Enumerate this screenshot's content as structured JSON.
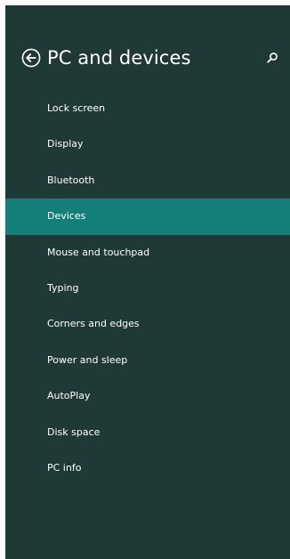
{
  "header": {
    "title": "PC and devices",
    "back_icon": "back-arrow-circle-icon",
    "search_icon": "search-icon"
  },
  "colors": {
    "panel_background": "#1f3a36",
    "selected_background": "#138077",
    "text": "#ffffff"
  },
  "nav": {
    "selected_index": 3,
    "items": [
      {
        "label": "Lock screen"
      },
      {
        "label": "Display"
      },
      {
        "label": "Bluetooth"
      },
      {
        "label": "Devices"
      },
      {
        "label": "Mouse and touchpad"
      },
      {
        "label": "Typing"
      },
      {
        "label": "Corners and edges"
      },
      {
        "label": "Power and sleep"
      },
      {
        "label": "AutoPlay"
      },
      {
        "label": "Disk space"
      },
      {
        "label": "PC info"
      }
    ]
  }
}
